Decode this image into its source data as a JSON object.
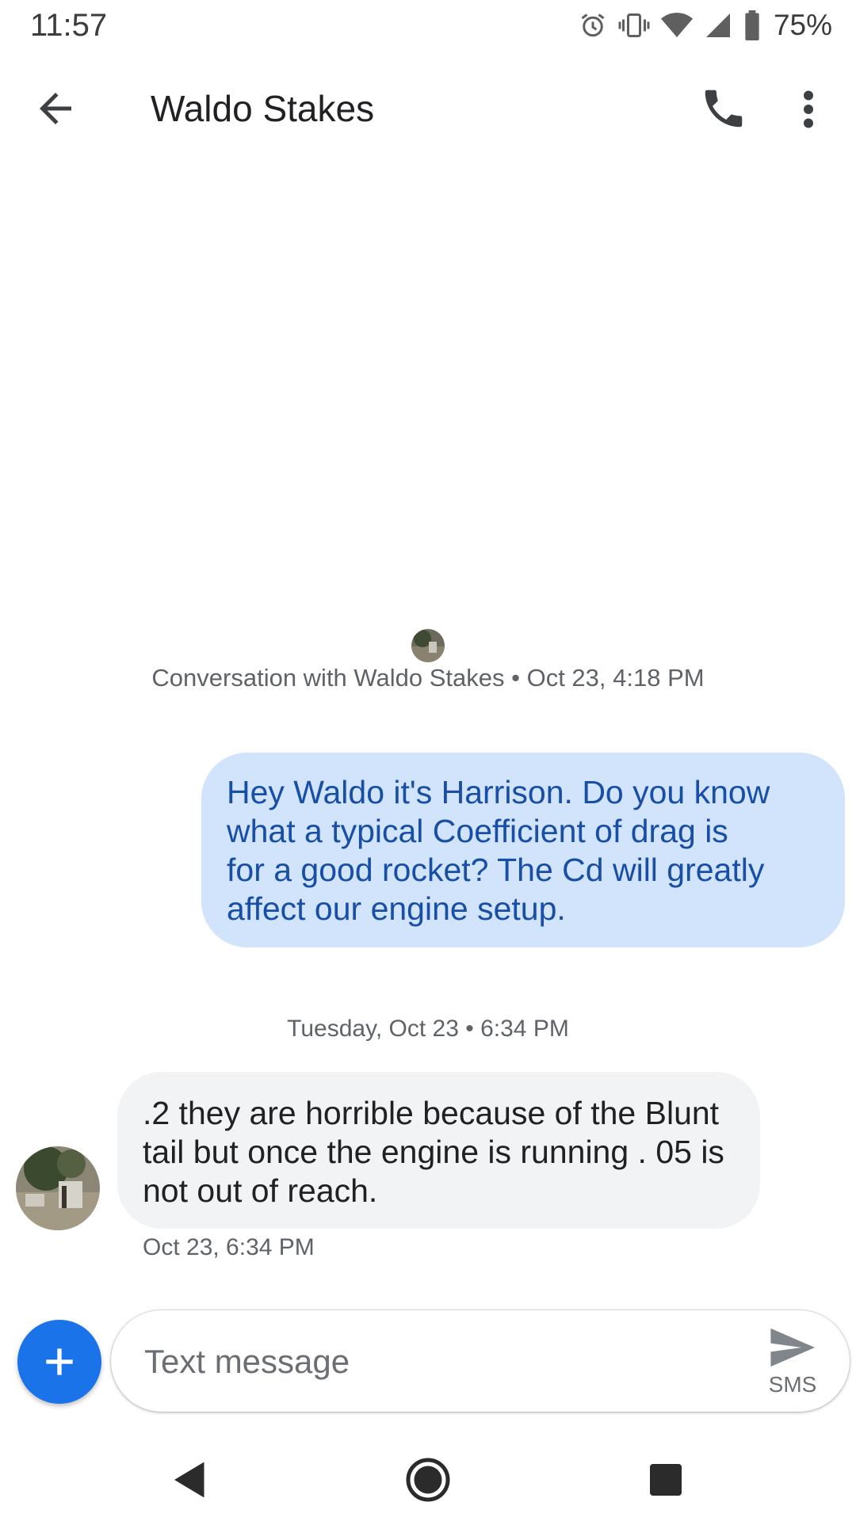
{
  "status_bar": {
    "time": "11:57",
    "battery_percent": "75%",
    "icons": [
      "alarm-icon",
      "vibrate-icon",
      "wifi-icon",
      "cell-signal-icon",
      "battery-icon"
    ]
  },
  "app_bar": {
    "contact_name": "Waldo Stakes",
    "icons": [
      "back-arrow-icon",
      "phone-icon",
      "more-vert-icon"
    ]
  },
  "conversation": {
    "header": "Conversation with Waldo Stakes • Oct 23, 4:18 PM",
    "messages": [
      {
        "direction": "outgoing",
        "text": "Hey Waldo it's Harrison.  Do you know\nwhat a typical Coefficient of drag is\nfor a good rocket?  The Cd will greatly\naffect our engine setup."
      },
      {
        "direction": "divider",
        "text": "Tuesday, Oct 23 • 6:34 PM"
      },
      {
        "direction": "incoming",
        "text": ".2 they are horrible because of the Blunt\ntail but once the engine is running . 05 is\nnot out of reach.",
        "timestamp": "Oct 23, 6:34 PM"
      }
    ]
  },
  "composer": {
    "placeholder": "Text message",
    "value": "",
    "send_label": "SMS"
  },
  "colors": {
    "outgoing_bubble": "#d2e3fc",
    "outgoing_text": "#174ea6",
    "incoming_bubble": "#f1f3f4",
    "fab": "#1a73e8"
  }
}
